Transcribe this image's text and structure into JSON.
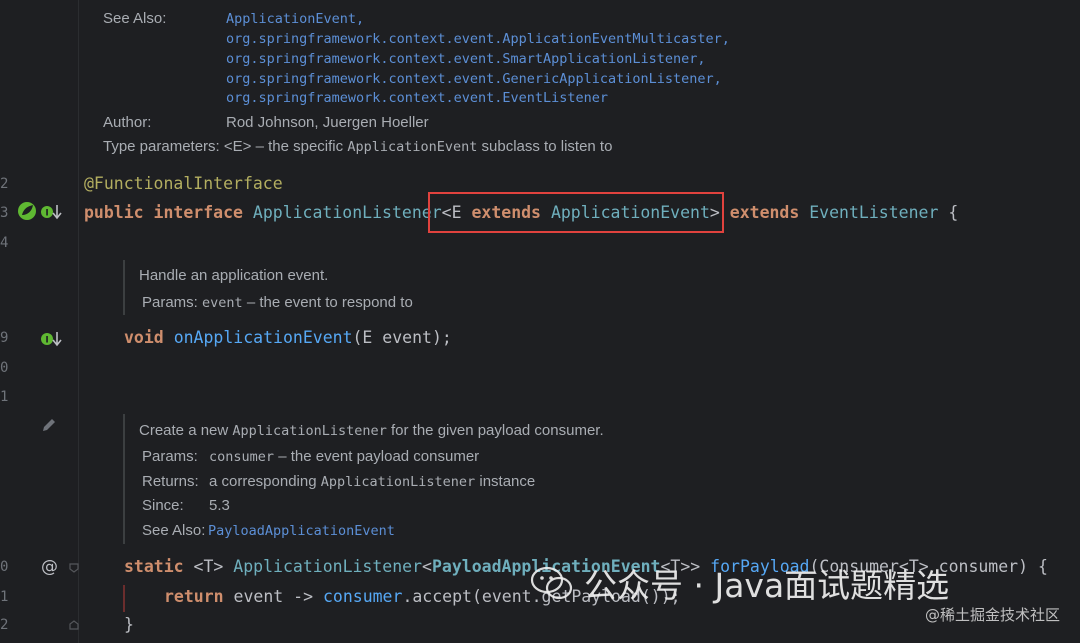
{
  "gutter": {
    "line_numbers": [
      "2",
      "3",
      "4",
      "9",
      "0",
      "1",
      "0",
      "1",
      "2"
    ]
  },
  "doc1": {
    "see_also_label": "See Also:",
    "see_also_links": [
      "ApplicationEvent,",
      "org.springframework.context.event.ApplicationEventMulticaster,",
      "org.springframework.context.event.SmartApplicationListener,",
      "org.springframework.context.event.GenericApplicationListener,",
      "org.springframework.context.event.EventListener"
    ],
    "author_label": "Author:",
    "author_value": "Rod Johnson, Juergen Hoeller",
    "type_params_label": "Type parameters:",
    "type_params_pre": "<E> – the specific",
    "type_params_code": "ApplicationEvent",
    "type_params_post": "subclass to listen to"
  },
  "code": {
    "annotation": "@FunctionalInterface",
    "decl": {
      "public": "public",
      "interface": "interface",
      "name": "ApplicationListener",
      "lt": "<",
      "E": "E ",
      "extends": "extends",
      "bound": "ApplicationEvent",
      "gt": ">",
      "extends2": "extends",
      "parent": "EventListener",
      "brace": "{"
    },
    "method1": {
      "void": "void",
      "name": "onApplicationEvent",
      "params": "(E event);"
    },
    "method2": {
      "static": "static",
      "generic": "<T>",
      "ret": "ApplicationListener",
      "lt": "<",
      "payload": "PayloadApplicationEvent",
      "gt": "<T>>",
      "name": "forPayload",
      "p1": "(Consumer<T> consumer) {"
    },
    "return_line": {
      "ret": "return",
      "rest1": " event -> ",
      "consumer": "consumer",
      "rest2": ".accept(event.getPayload());"
    },
    "close_brace": "}"
  },
  "doc2": {
    "text": "Handle an application event.",
    "params_label": "Params:",
    "params_code": "event",
    "params_rest": "– the event to respond to"
  },
  "doc3": {
    "line1_pre": "Create a new",
    "line1_code": "ApplicationListener",
    "line1_post": "for the given payload consumer.",
    "params_label": "Params:",
    "params_code": "consumer",
    "params_rest": "– the event payload consumer",
    "returns_label": "Returns:",
    "returns_pre": "a corresponding",
    "returns_code": "ApplicationListener",
    "returns_post": "instance",
    "since_label": "Since:",
    "since_value": "5.3",
    "see_also_label": "See Also:",
    "see_also_link": "PayloadApplicationEvent"
  },
  "watermark": {
    "main": "公众号 · Java面试题精选",
    "secondary": "@稀土掘金技术社区"
  },
  "colors": {
    "background": "#1e1f22",
    "keyword": "#cf8e6d",
    "highlight_box": "#e0423e",
    "link": "#5c8fd6"
  }
}
